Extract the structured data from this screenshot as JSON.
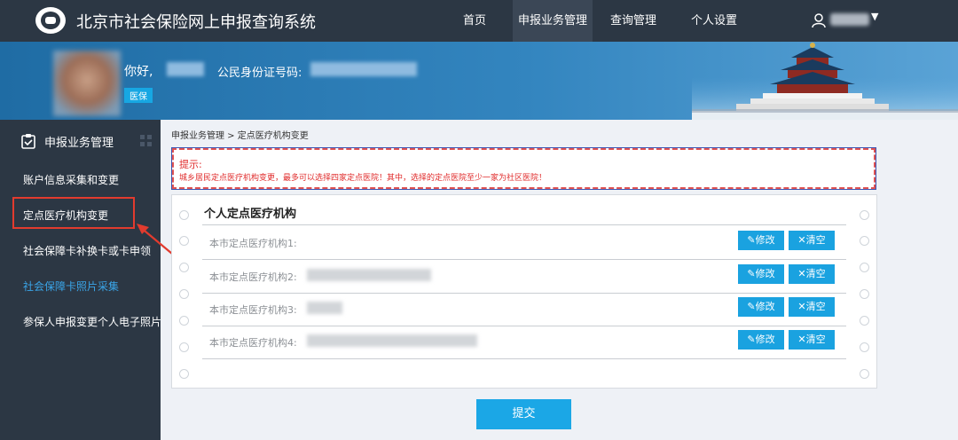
{
  "header": {
    "system_title": "北京市社会保险网上申报查询系统",
    "nav": [
      "首页",
      "申报业务管理",
      "查询管理",
      "个人设置"
    ],
    "active_nav": 1
  },
  "banner": {
    "greeting": "你好,",
    "id_label": "公民身份证号码:",
    "badge": "医保"
  },
  "sidebar": {
    "title": "申报业务管理",
    "items": [
      "账户信息采集和变更",
      "定点医疗机构变更",
      "社会保障卡补换卡或卡申领",
      "社会保障卡照片采集",
      "参保人申报变更个人电子照片"
    ]
  },
  "breadcrumb": "申报业务管理 > 定点医疗机构变更",
  "tip": {
    "title": "提示:",
    "text": "城乡居民定点医疗机构变更，最多可以选择四家定点医院！其中，选择的定点医院至少一家为社区医院！"
  },
  "panel": {
    "title": "个人定点医疗机构",
    "rows": [
      {
        "label": "本市定点医疗机构1:"
      },
      {
        "label": "本市定点医疗机构2:"
      },
      {
        "label": "本市定点医疗机构3:"
      },
      {
        "label": "本市定点医疗机构4:"
      }
    ],
    "edit_label": "修改",
    "clear_label": "清空"
  },
  "submit_label": "提交",
  "colors": {
    "nav_bg": "#2c3744",
    "accent": "#1aa2e0",
    "warning": "#e02b2b"
  }
}
